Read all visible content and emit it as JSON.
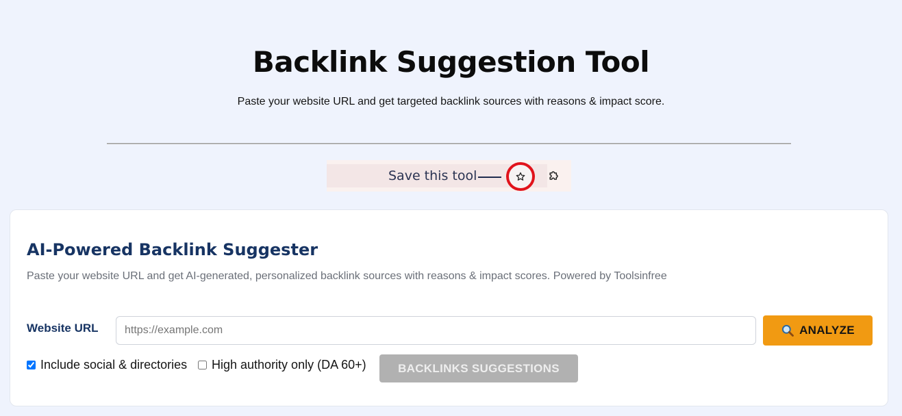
{
  "header": {
    "title": "Backlink Suggestion Tool",
    "subtitle": "Paste your website URL and get targeted backlink sources with reasons & impact score."
  },
  "save_bar": {
    "label": "Save this tool",
    "bookmark_icon": "star-icon",
    "extension_icon": "puzzle-piece-icon",
    "highlight_color": "#e1131b"
  },
  "card": {
    "title": "AI-Powered Backlink Suggester",
    "description": "Paste your website URL and get AI-generated, personalized backlink sources with reasons & impact scores. Powered by Toolsinfree",
    "url_label": "Website URL",
    "url_placeholder": "https://example.com",
    "url_value": "",
    "analyze_label": "ANALYZE",
    "analyze_icon": "magnifier-icon",
    "options": [
      {
        "label": "Include social & directories",
        "checked": true
      },
      {
        "label": "High authority only (DA 60+)",
        "checked": false
      }
    ],
    "suggestions_label": "BACKLINKS SUGGESTIONS",
    "suggestions_enabled": false
  },
  "colors": {
    "background": "#eff3fd",
    "accent": "#f19a12",
    "heading": "#173463",
    "disabled": "#b1b1b1"
  }
}
